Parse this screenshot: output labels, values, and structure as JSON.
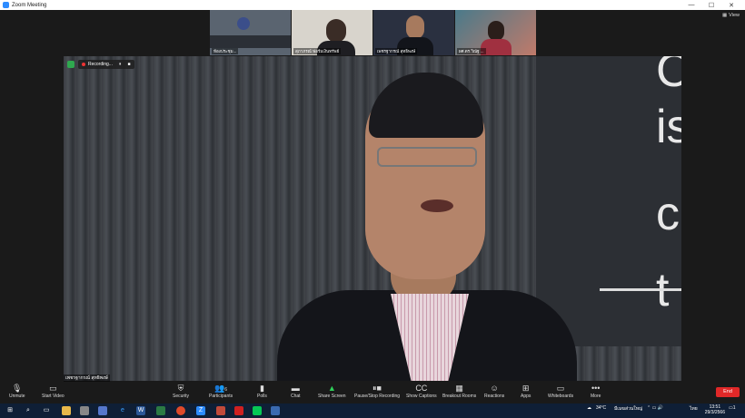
{
  "window": {
    "title": "Zoom Meeting",
    "view_label": "View"
  },
  "thumbnails": [
    {
      "name": "ห้องประชุม...",
      "bg": "#5a6470"
    },
    {
      "name": "สุภาภรณ์ ฟอร์มเงินทรัพย์",
      "bg": "#d8d4cc"
    },
    {
      "name": "เพชรฐากรณ์ สุทธิพงษ์",
      "bg": "#2a3040"
    },
    {
      "name": "ผศ.ดร.วิณัฐ ...",
      "bg": "#6a8a8a"
    }
  ],
  "recording": {
    "label": "Recording...",
    "pause": "⏸",
    "stop": "■"
  },
  "speaker": {
    "name": "เพชรฐากรณ์ สุทธิพงษ์"
  },
  "wall_text": [
    "C",
    "is",
    "c",
    "t"
  ],
  "toolbar": {
    "unmute": "Unmute",
    "start_video": "Start Video",
    "security": "Security",
    "participants": "Participants",
    "participants_count": "6",
    "polls": "Polls",
    "chat": "Chat",
    "share_screen": "Share Screen",
    "pause_stop_recording": "Pause/Stop Recording",
    "show_captions": "Show Captions",
    "breakout_rooms": "Breakout Rooms",
    "reactions": "Reactions",
    "apps": "Apps",
    "whiteboards": "Whiteboards",
    "more": "More",
    "end": "End"
  },
  "taskbar": {
    "weather": "34°C",
    "weather_desc": "มีเมฆส่วนใหญ่",
    "lang": "ไทย",
    "time": "13:51",
    "date": "29/3/2566",
    "notification_count": "1"
  },
  "colors": {
    "accent": "#2d8cff",
    "end": "#e02828",
    "share": "#2fd15a",
    "taskbar": "#0f1f36"
  }
}
